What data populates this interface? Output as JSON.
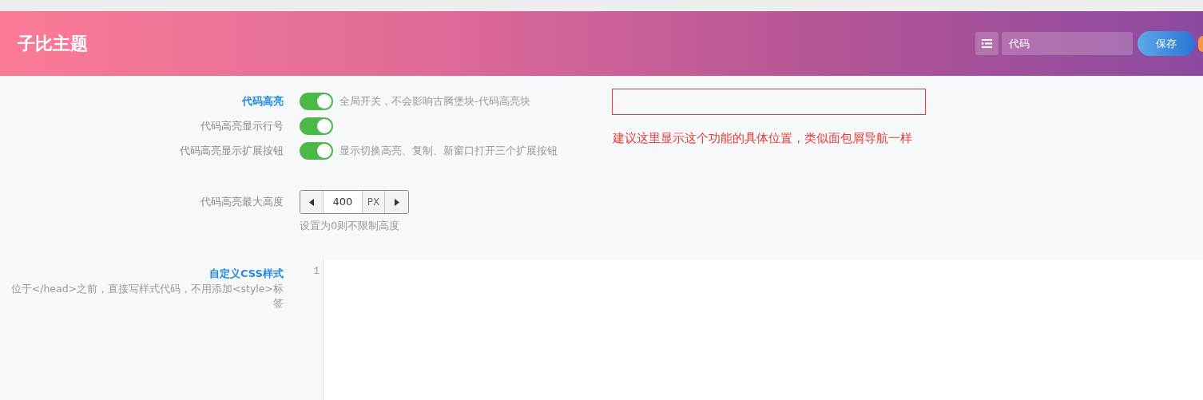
{
  "header": {
    "title": "子比主题",
    "search": {
      "value": "代码"
    },
    "save_button": "保存"
  },
  "settings": [
    {
      "kind": "switch",
      "label": "代码高亮",
      "highlighted": true,
      "on": true,
      "desc": "全局开关，不会影响古腾堡块-代码高亮块"
    },
    {
      "kind": "switch",
      "label": "代码高亮显示行号",
      "highlighted": false,
      "on": true
    },
    {
      "kind": "switch",
      "label": "代码高亮显示扩展按钮",
      "highlighted": false,
      "on": true,
      "desc": "显示切换高亮、复制、新窗口打开三个扩展按钮"
    },
    {
      "kind": "number",
      "label": "代码高亮最大高度",
      "highlighted": false,
      "value": "400",
      "unit": "PX",
      "hint": "设置为0则不限制高度"
    },
    {
      "kind": "code",
      "label": "自定义CSS样式",
      "highlighted": true,
      "subtitle": "位于</head>之前，直接写样式代码，不用添加<style>标签",
      "line_numbers": [
        "1"
      ]
    }
  ],
  "annotation": {
    "text": "建议这里显示这个功能的具体位置，类似面包屑导航一样"
  }
}
